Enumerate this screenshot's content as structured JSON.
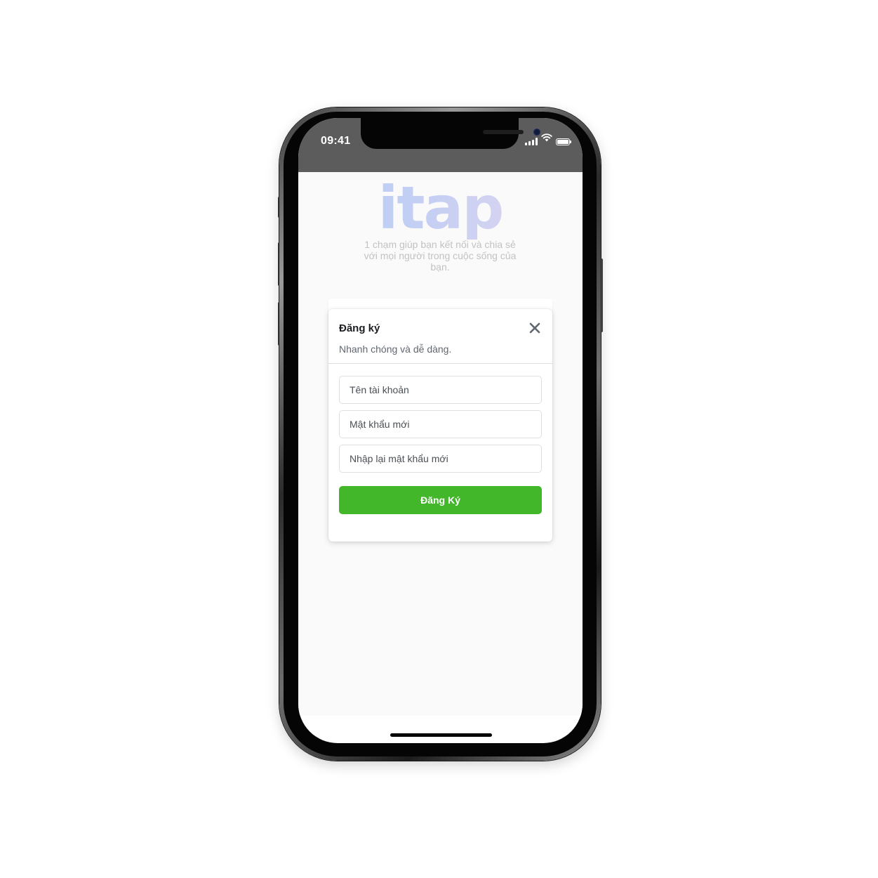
{
  "status_bar": {
    "time": "09:41",
    "icons": [
      "cellular-signal-icon",
      "wifi-icon",
      "battery-icon"
    ]
  },
  "app": {
    "logo_text": "itap",
    "tagline": "1 chạm giúp bạn kết nối và chia sẻ với mọi người trong cuộc sống của bạn."
  },
  "signup_modal": {
    "title": "Đăng ký",
    "subtitle": "Nhanh chóng và dễ dàng.",
    "close_icon": "close-icon",
    "fields": {
      "username": {
        "placeholder": "Tên tài khoản",
        "value": ""
      },
      "password": {
        "placeholder": "Mật khẩu mới",
        "value": ""
      },
      "confirm_password": {
        "placeholder": "Nhập lại mật khẩu mới",
        "value": ""
      }
    },
    "submit_label": "Đăng Ký"
  },
  "colors": {
    "status_bar_bg": "#5c5c5c",
    "submit_green": "#42b72a",
    "logo_gradient_start": "#b8cef7",
    "logo_gradient_end": "#e5d6ef"
  }
}
